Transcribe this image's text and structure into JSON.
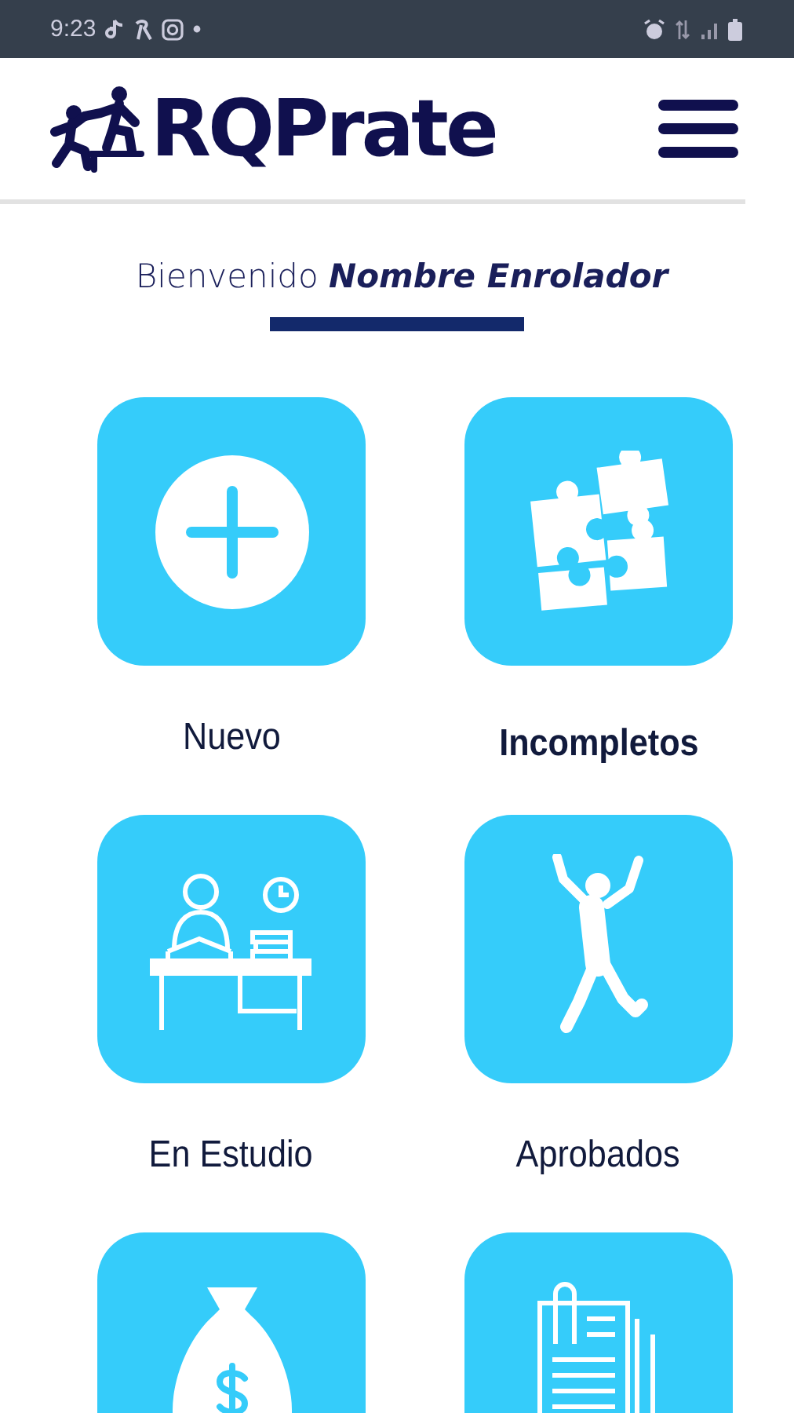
{
  "status_bar": {
    "time": "9:23"
  },
  "header": {
    "logo_text": "RQPrate"
  },
  "welcome": {
    "greeting": "Bienvenido",
    "name": "Nombre Enrolador"
  },
  "tiles": [
    {
      "kind": "plus",
      "label": "Nuevo",
      "selected": false
    },
    {
      "kind": "puzzle",
      "label": "Incompletos",
      "selected": true
    },
    {
      "kind": "study",
      "label": "En Estudio",
      "selected": false
    },
    {
      "kind": "jump",
      "label": "Aprobados",
      "selected": false
    },
    {
      "kind": "money"
    },
    {
      "kind": "documents"
    }
  ]
}
